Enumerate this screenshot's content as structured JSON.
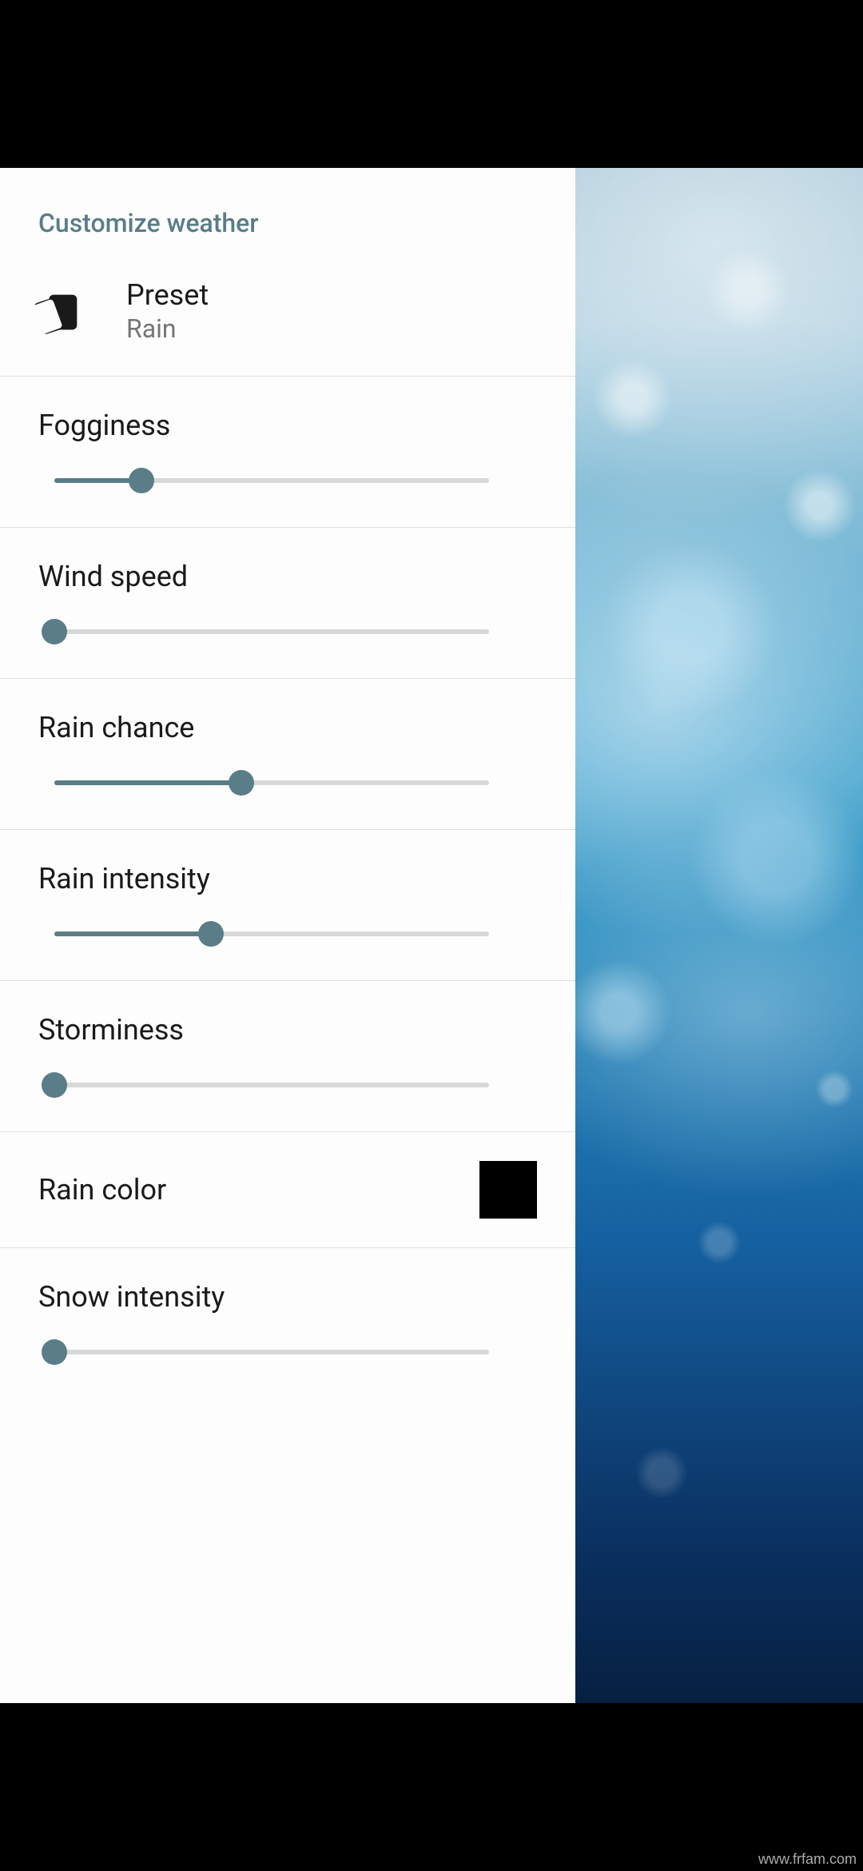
{
  "header": {
    "title": "Customize weather"
  },
  "preset": {
    "title": "Preset",
    "value": "Rain"
  },
  "sliders": [
    {
      "label": "Fogginess",
      "value": 20
    },
    {
      "label": "Wind speed",
      "value": 0
    },
    {
      "label": "Rain chance",
      "value": 43
    },
    {
      "label": "Rain intensity",
      "value": 36
    },
    {
      "label": "Storminess",
      "value": 0
    },
    {
      "label": "Snow intensity",
      "value": 0
    }
  ],
  "colorSetting": {
    "label": "Rain color",
    "hex": "#000000"
  },
  "watermark": "www.frfam.com"
}
